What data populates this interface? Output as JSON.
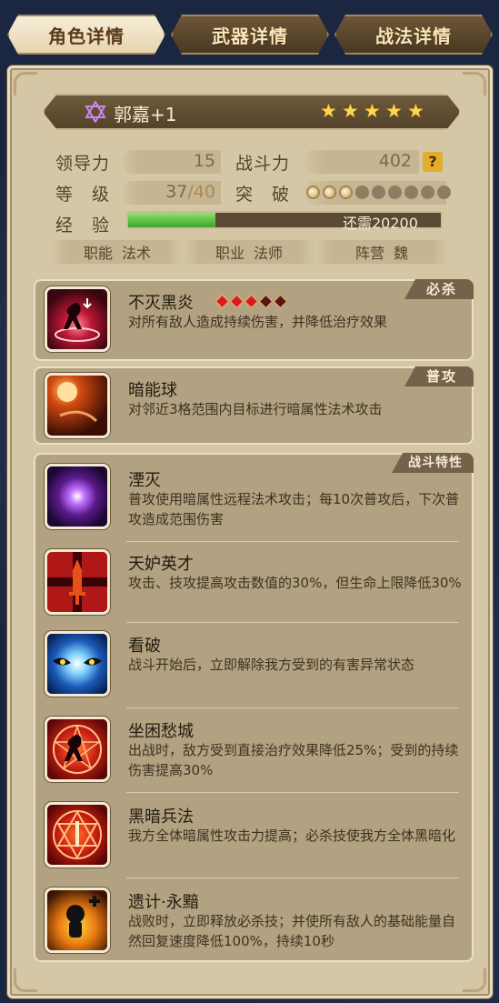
{
  "tabs": [
    {
      "label": "角色详情",
      "active": true
    },
    {
      "label": "武器详情",
      "active": false
    },
    {
      "label": "战法详情",
      "active": false
    }
  ],
  "hero": {
    "name": "郭嘉+1",
    "stars": 5,
    "leadership_label": "领导力",
    "leadership_value": "15",
    "power_label": "战斗力",
    "power_value": "402",
    "help_icon_text": "?",
    "level_label": "等　级",
    "level_current": "37",
    "level_sep": "/",
    "level_max": "40",
    "breakthrough_label": "突　破",
    "breakthrough_filled": 3,
    "breakthrough_total": 9,
    "exp_label": "经　验",
    "exp_progress": 0.28,
    "exp_text": "还需20200",
    "role_label": "职能",
    "role_value": "法术",
    "class_label": "职业",
    "class_value": "法师",
    "faction_label": "阵营",
    "faction_value": "魏"
  },
  "sections": {
    "ultimate": {
      "tag": "必杀",
      "skill": {
        "name": "不灭黑炎",
        "desc": "对所有敌人造成持续伤害，并降低治疗效果",
        "rank_filled": 3,
        "rank_total": 5,
        "icon": "shadow-flame-icon"
      }
    },
    "normal": {
      "tag": "普攻",
      "skill": {
        "name": "暗能球",
        "desc": "对邻近3格范围内目标进行暗属性法术攻击",
        "icon": "dark-orb-icon"
      }
    },
    "traits": {
      "tag": "战斗特性",
      "skills": [
        {
          "name": "湮灭",
          "desc": "普攻使用暗属性远程法术攻击；每10次普攻后，下次普攻造成范围伤害",
          "icon": "annihilation-icon"
        },
        {
          "name": "天妒英才",
          "desc": "攻击、技攻提高攻击数值的30%，但生命上限降低30%",
          "icon": "sword-cross-icon"
        },
        {
          "name": "看破",
          "desc": "战斗开始后，立即解除我方受到的有害异常状态",
          "icon": "eyes-icon"
        },
        {
          "name": "坐困愁城",
          "desc": "出战时，敌方受到直接治疗效果降低25%；受到的持续伤害提高30%",
          "icon": "pentagram-figure-icon"
        },
        {
          "name": "黑暗兵法",
          "desc": "我方全体暗属性攻击力提高；必杀技使我方全体黑暗化",
          "icon": "hexagram-sword-icon"
        },
        {
          "name": "遗计·永黯",
          "desc": "战败时，立即释放必杀技；并使所有敌人的基础能量自然回复速度降低100%，持续10秒",
          "icon": "bomb-figure-icon"
        }
      ]
    }
  },
  "colors": {
    "accent_gold": "#ffd84a",
    "exp_green": "#3aa62a",
    "rank_red": "#d81c1c",
    "rank_dark": "#5a1414"
  }
}
